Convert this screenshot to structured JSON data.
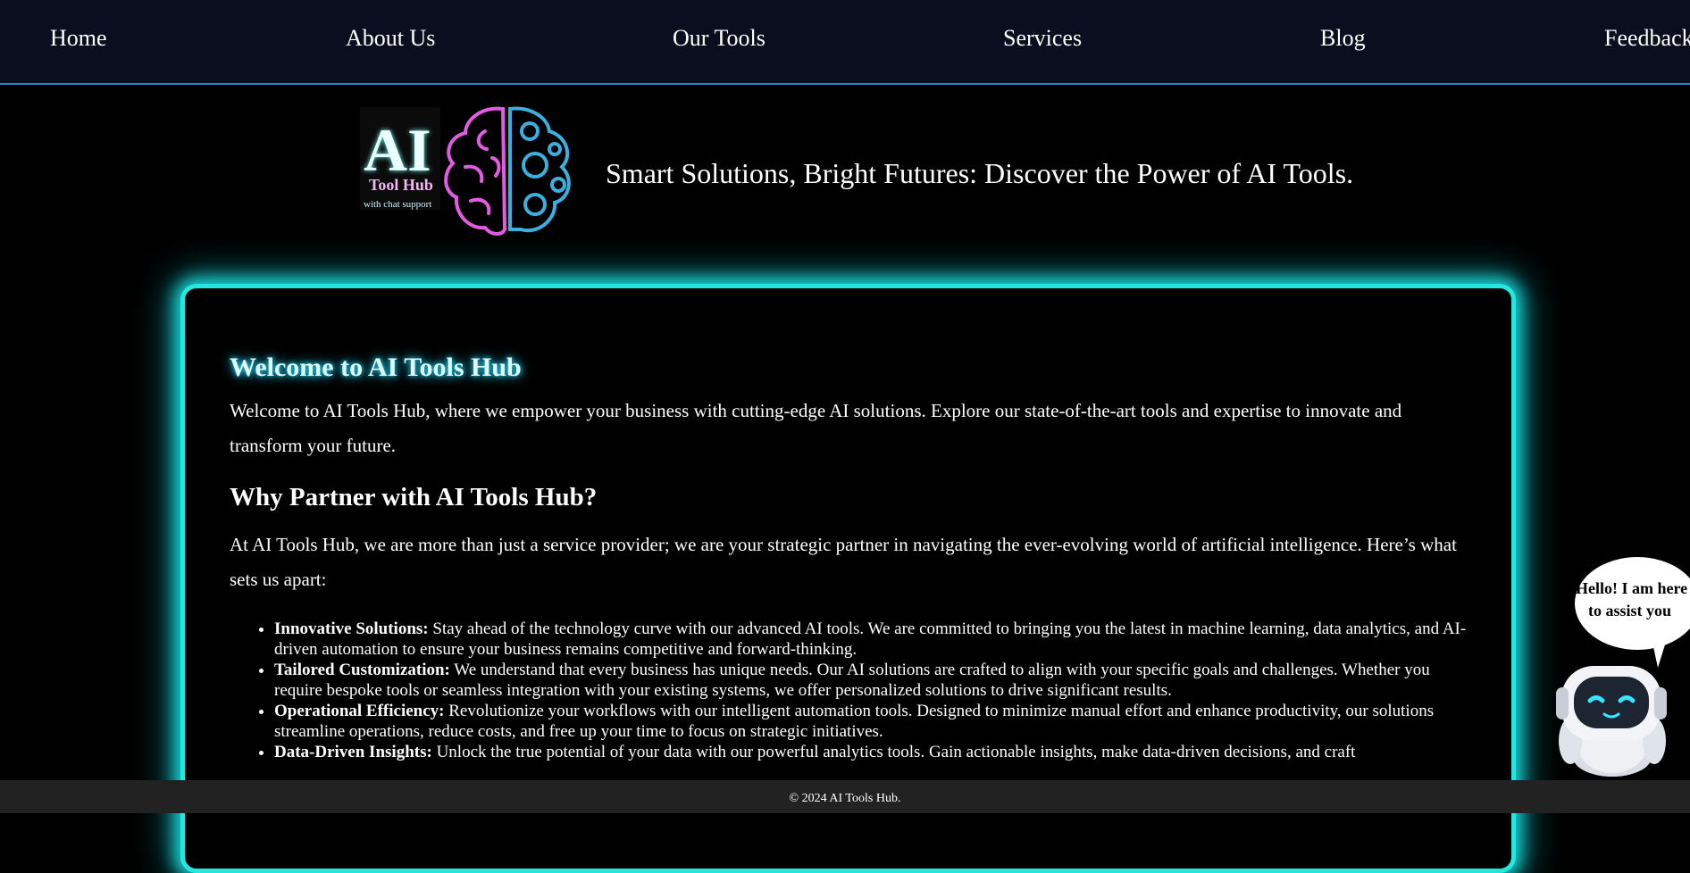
{
  "nav": {
    "items": [
      "Home",
      "About Us",
      "Our Tools",
      "Services",
      "Blog",
      "Feedback"
    ]
  },
  "header": {
    "logo": {
      "title": "AI",
      "subtitle": "Tool Hub",
      "caption": "with chat support"
    },
    "tagline": "Smart Solutions, Bright Futures: Discover the Power of AI Tools."
  },
  "main": {
    "welcome_title": "Welcome to AI Tools Hub",
    "welcome_text": "Welcome to AI Tools Hub, where we empower your business with cutting-edge AI solutions. Explore our state-of-the-art tools and expertise to innovate and transform your future.",
    "why_title": "Why Partner with AI Tools Hub?",
    "why_text": "At AI Tools Hub, we are more than just a service provider; we are your strategic partner in navigating the ever-evolving world of artificial intelligence. Here’s what sets us apart:",
    "features": [
      {
        "title": "Innovative Solutions:",
        "text": " Stay ahead of the technology curve with our advanced AI tools. We are committed to bringing you the latest in machine learning, data analytics, and AI-driven automation to ensure your business remains competitive and forward-thinking."
      },
      {
        "title": "Tailored Customization:",
        "text": " We understand that every business has unique needs. Our AI solutions are crafted to align with your specific goals and challenges. Whether you require bespoke tools or seamless integration with your existing systems, we offer personalized solutions to drive significant results."
      },
      {
        "title": "Operational Efficiency:",
        "text": " Revolutionize your workflows with our intelligent automation tools. Designed to minimize manual effort and enhance productivity, our solutions streamline operations, reduce costs, and free up your time to focus on strategic initiatives."
      },
      {
        "title": "Data-Driven Insights:",
        "text": " Unlock the true potential of your data with our powerful analytics tools. Gain actionable insights, make data-driven decisions, and craft"
      }
    ]
  },
  "chatbot": {
    "bubble_line1": "Hello! I am here",
    "bubble_line2": "to assist you"
  },
  "footer": {
    "text": "© 2024 AI Tools Hub."
  },
  "colors": {
    "nav_bg": "#0a0e1f",
    "nav_border": "#2a7fd0",
    "glow": "#26e6e0",
    "logo_pink": "#e25be0",
    "logo_blue": "#3ab0e0"
  }
}
